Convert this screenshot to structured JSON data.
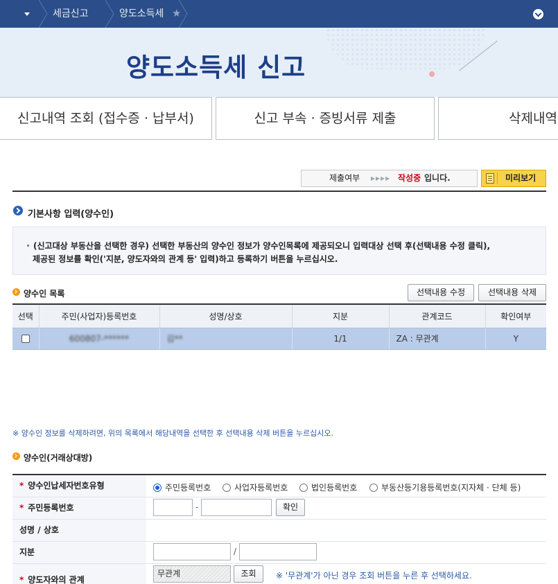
{
  "nav": {
    "crumbs": [
      "세금신고",
      "양도소득세"
    ]
  },
  "hero": {
    "title": "양도소득세 신고"
  },
  "tabs": [
    "신고내역 조회 (접수증 · 납부서)",
    "신고 부속 · 증빙서류 제출",
    "삭제내역"
  ],
  "status": {
    "label": "제출여부",
    "arrows": "▸▸▸▸",
    "value": "작성중",
    "suffix": "입니다.",
    "preview": "미리보기"
  },
  "section1": {
    "title": "기본사항 입력(양수인)",
    "info_line1": "(신고대상 부동산을 선택한 경우) 선택한 부동산의 양수인 정보가 양수인목록에 제공되오니 입력대상 선택 후(선택내용 수정 클릭),",
    "info_line2": "제공된 정보를 확인('지분, 양도자와의 관계 등' 입력)하고 등록하기 버튼을 누르십시오."
  },
  "list": {
    "title": "양수인 목록",
    "edit_btn": "선택내용 수정",
    "delete_btn": "선택내용 삭제",
    "headers": [
      "선택",
      "주민(사업자)등록번호",
      "성명/상호",
      "지분",
      "관계코드",
      "확인여부"
    ],
    "rows": [
      {
        "id": "600807-******",
        "name": "김**",
        "share": "1/1",
        "rel": "ZA : 무관계",
        "confirm": "Y"
      }
    ]
  },
  "note": "※ 양수인 정보를 삭제하려면, 위의 목록에서 해당내역을 선택한 후 선택내용 삭제 버튼을 누르십시오.",
  "form": {
    "title": "양수인(거래상대방)",
    "req_mark": "*",
    "type_label": "양수인납세자번호유형",
    "type_options": [
      "주민등록번호",
      "사업자등록번호",
      "법인등록번호",
      "부동산등기용등록번호(지자체 · 단체 등)"
    ],
    "rrn_label": "주민등록번호",
    "rrn_dash": "-",
    "confirm_btn": "확인",
    "name_label": "성명 / 상호",
    "share_label": "지분",
    "share_slash": "/",
    "rel_label": "양도자와의 관계",
    "rel_value": "무관계",
    "lookup_btn": "조회",
    "rel_hint": "※ '무관계'가 아닌 경우 조회 버튼을 누른 후 선택하세요."
  }
}
